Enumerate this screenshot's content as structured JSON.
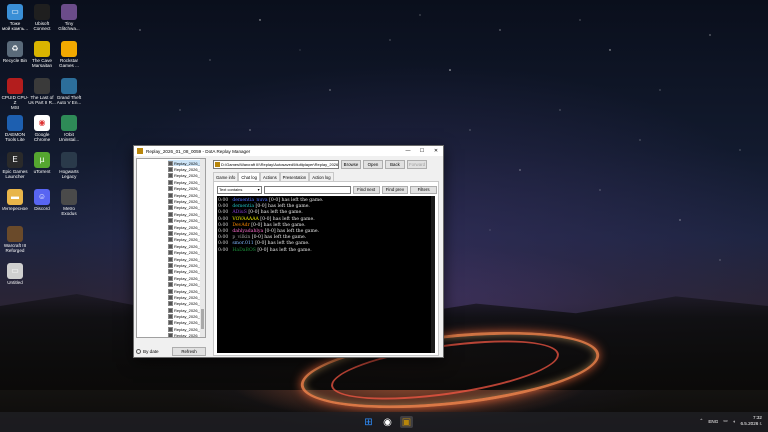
{
  "desktop": {
    "icons": [
      {
        "label": "Тоже\nмой компь...",
        "icon": "computer-icon",
        "color": "#3a8fd6"
      },
      {
        "label": "Ubisoft\nConnect",
        "icon": "ubisoft-icon",
        "color": "#1f1f1f"
      },
      {
        "label": "Tiny\nGlitchwa...",
        "icon": "game-icon",
        "color": "#6b4c8a"
      },
      {
        "label": "Recycle Bin",
        "icon": "recycle-bin-icon",
        "color": "#5a6a7a"
      },
      {
        "label": "The Cave\nMarsaitan",
        "icon": "game-icon",
        "color": "#d9b400"
      },
      {
        "label": "Rockstar\nGames ...",
        "icon": "rockstar-icon",
        "color": "#f2a900"
      },
      {
        "label": "CPUID CPU-Z\nMSI",
        "icon": "cpuz-icon",
        "color": "#b31d1d"
      },
      {
        "label": "The Last of\nUs Part II R...",
        "icon": "game-icon",
        "color": "#3a3a3a"
      },
      {
        "label": "Grand Theft\nAuto V En...",
        "icon": "gta-icon",
        "color": "#2c6e9a"
      },
      {
        "label": "DAEMON\nTools Lite",
        "icon": "daemon-tools-icon",
        "color": "#1d5fb0"
      },
      {
        "label": "Google\nChrome",
        "icon": "chrome-icon",
        "color": "#ffffff"
      },
      {
        "label": "IObit\nUninstal...",
        "icon": "iobit-icon",
        "color": "#2e8b57"
      },
      {
        "label": "Epic Games\nLauncher",
        "icon": "epic-games-icon",
        "color": "#2a2a2a"
      },
      {
        "label": "uTorrent",
        "icon": "utorrent-icon",
        "color": "#55a630"
      },
      {
        "label": "Hogwarts\nLegacy",
        "icon": "game-icon",
        "color": "#2a3a4a"
      },
      {
        "label": "Интересное",
        "icon": "folder-icon",
        "color": "#e8b54a"
      },
      {
        "label": "Discord",
        "icon": "discord-icon",
        "color": "#5865f2"
      },
      {
        "label": "Metro\nExodus",
        "icon": "game-icon",
        "color": "#4a4a4a"
      },
      {
        "label": "Warcraft III\nReforged",
        "icon": "game-icon",
        "color": "#6a4a2a"
      },
      {
        "label": "Untitled",
        "icon": "file-icon",
        "color": "#d0d0d0"
      }
    ]
  },
  "window": {
    "title": "Replay_2026_01_08_0059 - DotA Replay Manager",
    "controls": {
      "minimize": "—",
      "maximize": "☐",
      "close": "✕"
    },
    "replays": [
      "Replay_2026_01_08",
      "Replay_2026_0",
      "Replay_2026_0",
      "Replay_2026_0",
      "Replay_2026_0",
      "Replay_2026_0",
      "Replay_2026_0",
      "Replay_2026_0",
      "Replay_2026_0",
      "Replay_2026_0",
      "Replay_2026_0",
      "Replay_2026_0",
      "Replay_2026_0",
      "Replay_2026_0",
      "Replay_2026_0",
      "Replay_2026_0",
      "Replay_2026_0",
      "Replay_2026_0",
      "Replay_2026_0",
      "Replay_2026_0",
      "Replay_2026_0",
      "Replay_2026_0",
      "Replay_2026_0",
      "Replay_2026_0",
      "Replay_2026_0",
      "Replay_2026_0",
      "Replay_2026_0",
      "Replay_2026_0"
    ],
    "by_date_label": "By date",
    "refresh_label": "Refresh",
    "path": "D:\\Games\\Warcraft III\\Replay\\Autosaved\\Multiplayer\\Replay_2026",
    "browse_label": "Browse",
    "open_label": "Open",
    "back_label": "Back",
    "forward_label": "Forward",
    "tabs": [
      "Game info",
      "Chat log",
      "Actions",
      "Presentation",
      "Action log"
    ],
    "active_tab": 1,
    "filter_select": "Text contains",
    "find_next_label": "Find next",
    "find_prev_label": "Find prev",
    "filters_label": "Filters",
    "chat_log": [
      {
        "time": "0:00",
        "player": "dementia_nuva",
        "rest": "[0-0] has left the game.",
        "color": "#4a6cff"
      },
      {
        "time": "0:00",
        "player": "dementia",
        "rest": "[0-0] has left the game.",
        "color": "#1fbfbf"
      },
      {
        "time": "0:00",
        "player": "ADiuS",
        "rest": "[0-0] has left the game.",
        "color": "#8a3fd6"
      },
      {
        "time": "0:00",
        "player": "VOVAAAAA",
        "rest": "[0-0] has left the game.",
        "color": "#f0f000"
      },
      {
        "time": "0:00",
        "player": "DevAdr",
        "rest": "[0-0] has left the game.",
        "color": "#ff8a00"
      },
      {
        "time": "0:00",
        "player": "dahlyadahlya",
        "rest": "[0-0] has left the game.",
        "color": "#ff6fd0"
      },
      {
        "time": "0:00",
        "player": "p_vilkin",
        "rest": "[0-0] has left the game.",
        "color": "#9a9a9a"
      },
      {
        "time": "0:00",
        "player": "smor.011",
        "rest": "[0-0] has left the game.",
        "color": "#7fb8ff"
      },
      {
        "time": "0:00",
        "player": "HaDaBOS",
        "rest": "[0-0] has left the game.",
        "color": "#1a8f3a"
      }
    ]
  },
  "taskbar": {
    "apps": [
      {
        "icon": "windows-start-icon",
        "color": "#2f8fff"
      },
      {
        "icon": "chrome-icon",
        "color": "#ffffff"
      },
      {
        "icon": "replay-manager-icon",
        "color": "#b8860b"
      }
    ],
    "lang": "ENG",
    "time": "7:32",
    "date": "6.5.2026 г."
  }
}
